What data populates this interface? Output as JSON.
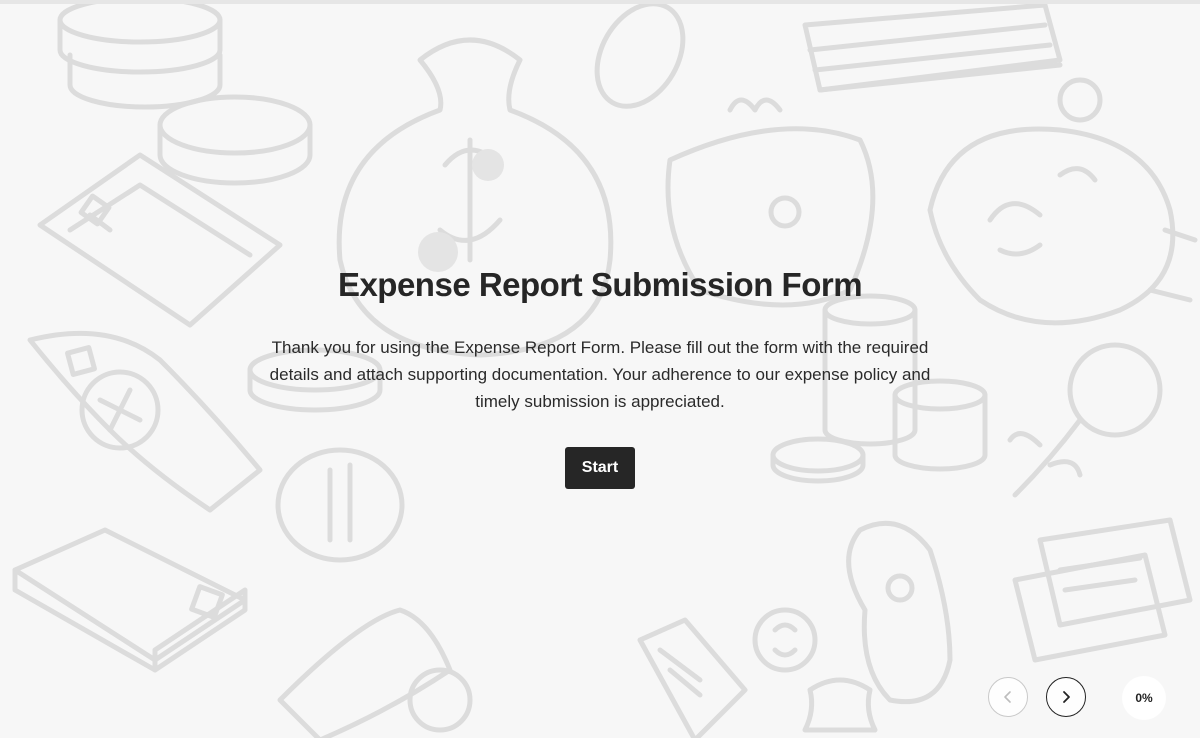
{
  "form": {
    "title": "Expense Report Submission Form",
    "intro": "Thank you for using the Expense Report Form. Please fill out the form with the required details and attach supporting documentation. Your adherence to our expense policy and timely submission is appreciated.",
    "start_label": "Start"
  },
  "navigation": {
    "prev_icon": "chevron-left-icon",
    "next_icon": "chevron-right-icon",
    "progress_label": "0%",
    "progress_value": 0
  },
  "colors": {
    "background": "#f7f7f7",
    "button": "#262626",
    "button_text": "#ffffff",
    "doodle": "#dcdcdc"
  }
}
